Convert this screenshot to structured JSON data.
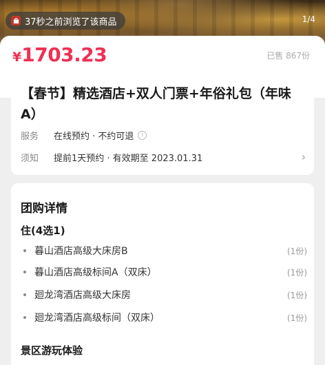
{
  "hero": {
    "viewed_text": "37秒之前浏览了该商品",
    "page_indicator": "1/4"
  },
  "price": {
    "currency": "¥",
    "amount": "1703.23",
    "sold": "已售 867份",
    "color": "#f03055"
  },
  "product": {
    "title": "【春节】精选酒店+双人门票+年俗礼包（年味A）",
    "service_label": "服务",
    "service_value": "在线预约 · 不约可退",
    "notice_label": "须知",
    "notice_value": "提前1天预约 · 有效期至 2023.01.31"
  },
  "details": {
    "heading": "团购详情",
    "stay": {
      "heading": "住(4选1)",
      "items": [
        {
          "name": "暮山酒店高级大床房B",
          "qty": "(1份)"
        },
        {
          "name": "暮山酒店高级标间A（双床）",
          "qty": "(1份)"
        },
        {
          "name": "廻龙湾酒店高级大床房",
          "qty": "(1份)"
        },
        {
          "name": "廻龙湾酒店高级标间（双床）",
          "qty": "(1份)"
        }
      ]
    },
    "scenic_heading": "景区游玩体验"
  }
}
